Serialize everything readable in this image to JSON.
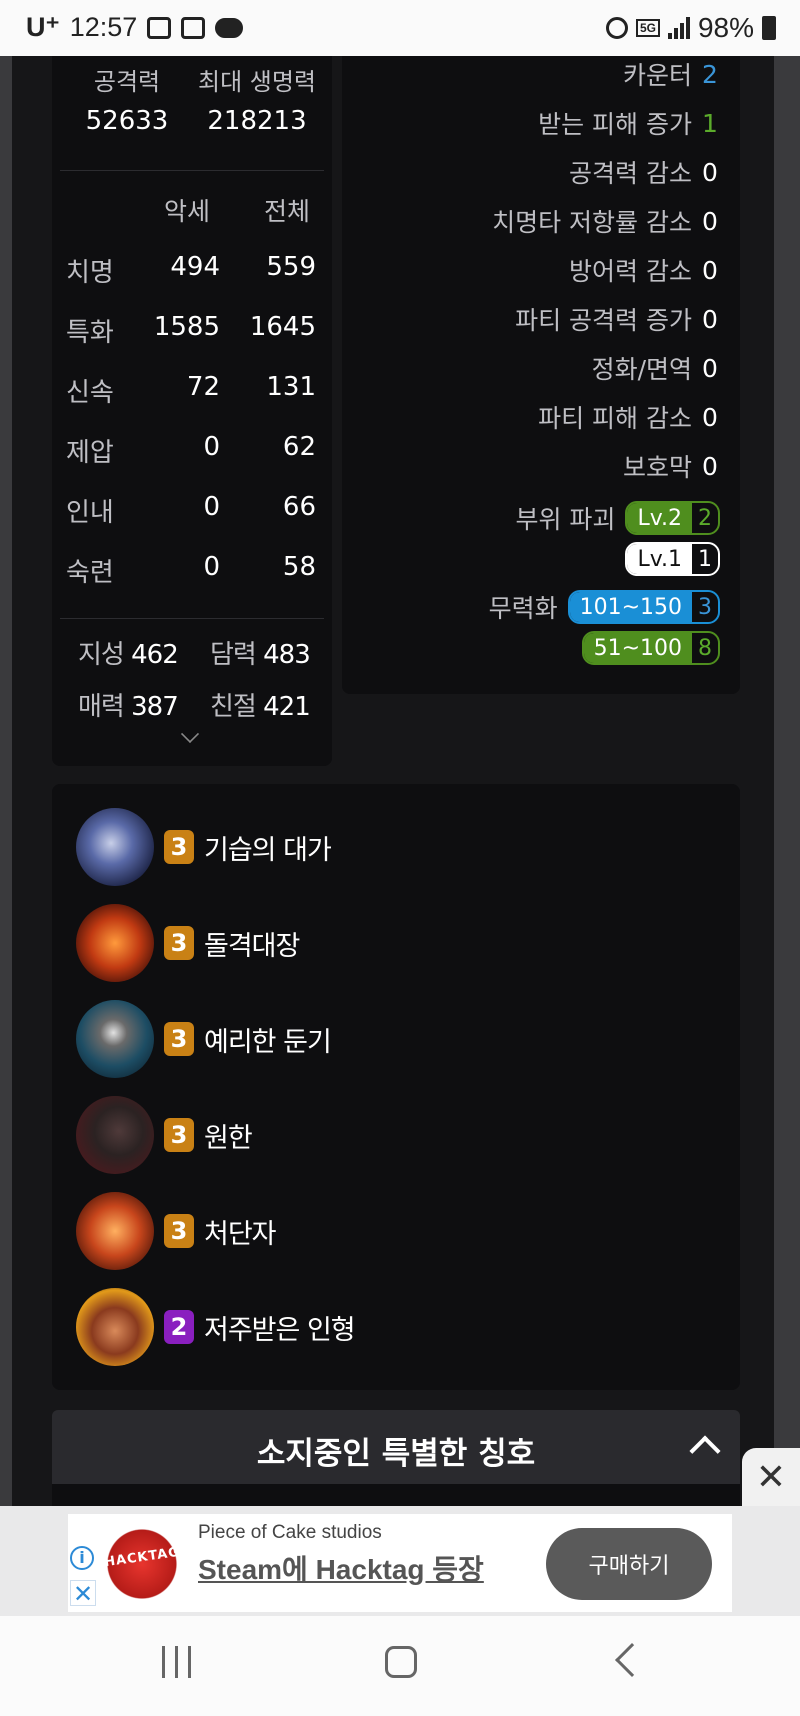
{
  "status_bar": {
    "carrier": "U⁺",
    "time": "12:57",
    "network": "5G",
    "battery": "98%"
  },
  "stats": {
    "headers": [
      "공격력",
      "최대 생명력"
    ],
    "values": [
      "52633",
      "218213"
    ],
    "col_headers": [
      "악세",
      "전체"
    ],
    "rows": [
      {
        "label": "치명",
        "acc": "494",
        "total": "559"
      },
      {
        "label": "특화",
        "acc": "1585",
        "total": "1645"
      },
      {
        "label": "신속",
        "acc": "72",
        "total": "131"
      },
      {
        "label": "제압",
        "acc": "0",
        "total": "62"
      },
      {
        "label": "인내",
        "acc": "0",
        "total": "66"
      },
      {
        "label": "숙련",
        "acc": "0",
        "total": "58"
      }
    ],
    "attrs": [
      {
        "label": "지성",
        "value": "462"
      },
      {
        "label": "담력",
        "value": "483"
      },
      {
        "label": "매력",
        "value": "387"
      },
      {
        "label": "친절",
        "value": "421"
      }
    ]
  },
  "effects": {
    "rows": [
      {
        "label": "카운터",
        "value": "2",
        "color": "#3a95d8"
      },
      {
        "label": "받는 피해 증가",
        "value": "1",
        "color": "#5bab2b"
      },
      {
        "label": "공격력 감소",
        "value": "0"
      },
      {
        "label": "치명타 저항률 감소",
        "value": "0"
      },
      {
        "label": "방어력 감소",
        "value": "0"
      },
      {
        "label": "파티 공격력 증가",
        "value": "0"
      },
      {
        "label": "정화/면역",
        "value": "0"
      },
      {
        "label": "파티 피해 감소",
        "value": "0"
      },
      {
        "label": "보호막",
        "value": "0"
      }
    ],
    "part_break": {
      "label": "부위 파괴",
      "pills": [
        {
          "level": "Lv.2",
          "count": "2"
        },
        {
          "level": "Lv.1",
          "count": "1"
        }
      ]
    },
    "neutralize": {
      "label": "무력화",
      "pills": [
        {
          "level": "101~150",
          "count": "3"
        },
        {
          "level": "51~100",
          "count": "8"
        }
      ]
    }
  },
  "engravings": [
    {
      "level": "3",
      "name": "기습의 대가",
      "badge_color": "#c98115",
      "icon": "assassin-portrait-icon"
    },
    {
      "level": "3",
      "name": "돌격대장",
      "badge_color": "#c98115",
      "icon": "fire-charge-icon"
    },
    {
      "level": "3",
      "name": "예리한 둔기",
      "badge_color": "#c98115",
      "icon": "spiked-mace-icon"
    },
    {
      "level": "3",
      "name": "원한",
      "badge_color": "#c98115",
      "icon": "werewolf-icon"
    },
    {
      "level": "3",
      "name": "처단자",
      "badge_color": "#c98115",
      "icon": "executioner-icon"
    },
    {
      "level": "2",
      "name": "저주받은 인형",
      "badge_color": "#8a1fbf",
      "icon": "cursed-doll-icon"
    }
  ],
  "titles_section": {
    "heading": "소지중인 특별한 칭호"
  },
  "ad": {
    "advertiser": "Piece of Cake studios",
    "headline": "Steam에 Hacktag 등장",
    "cta": "구매하기",
    "logo_text": "HACKTAG"
  }
}
